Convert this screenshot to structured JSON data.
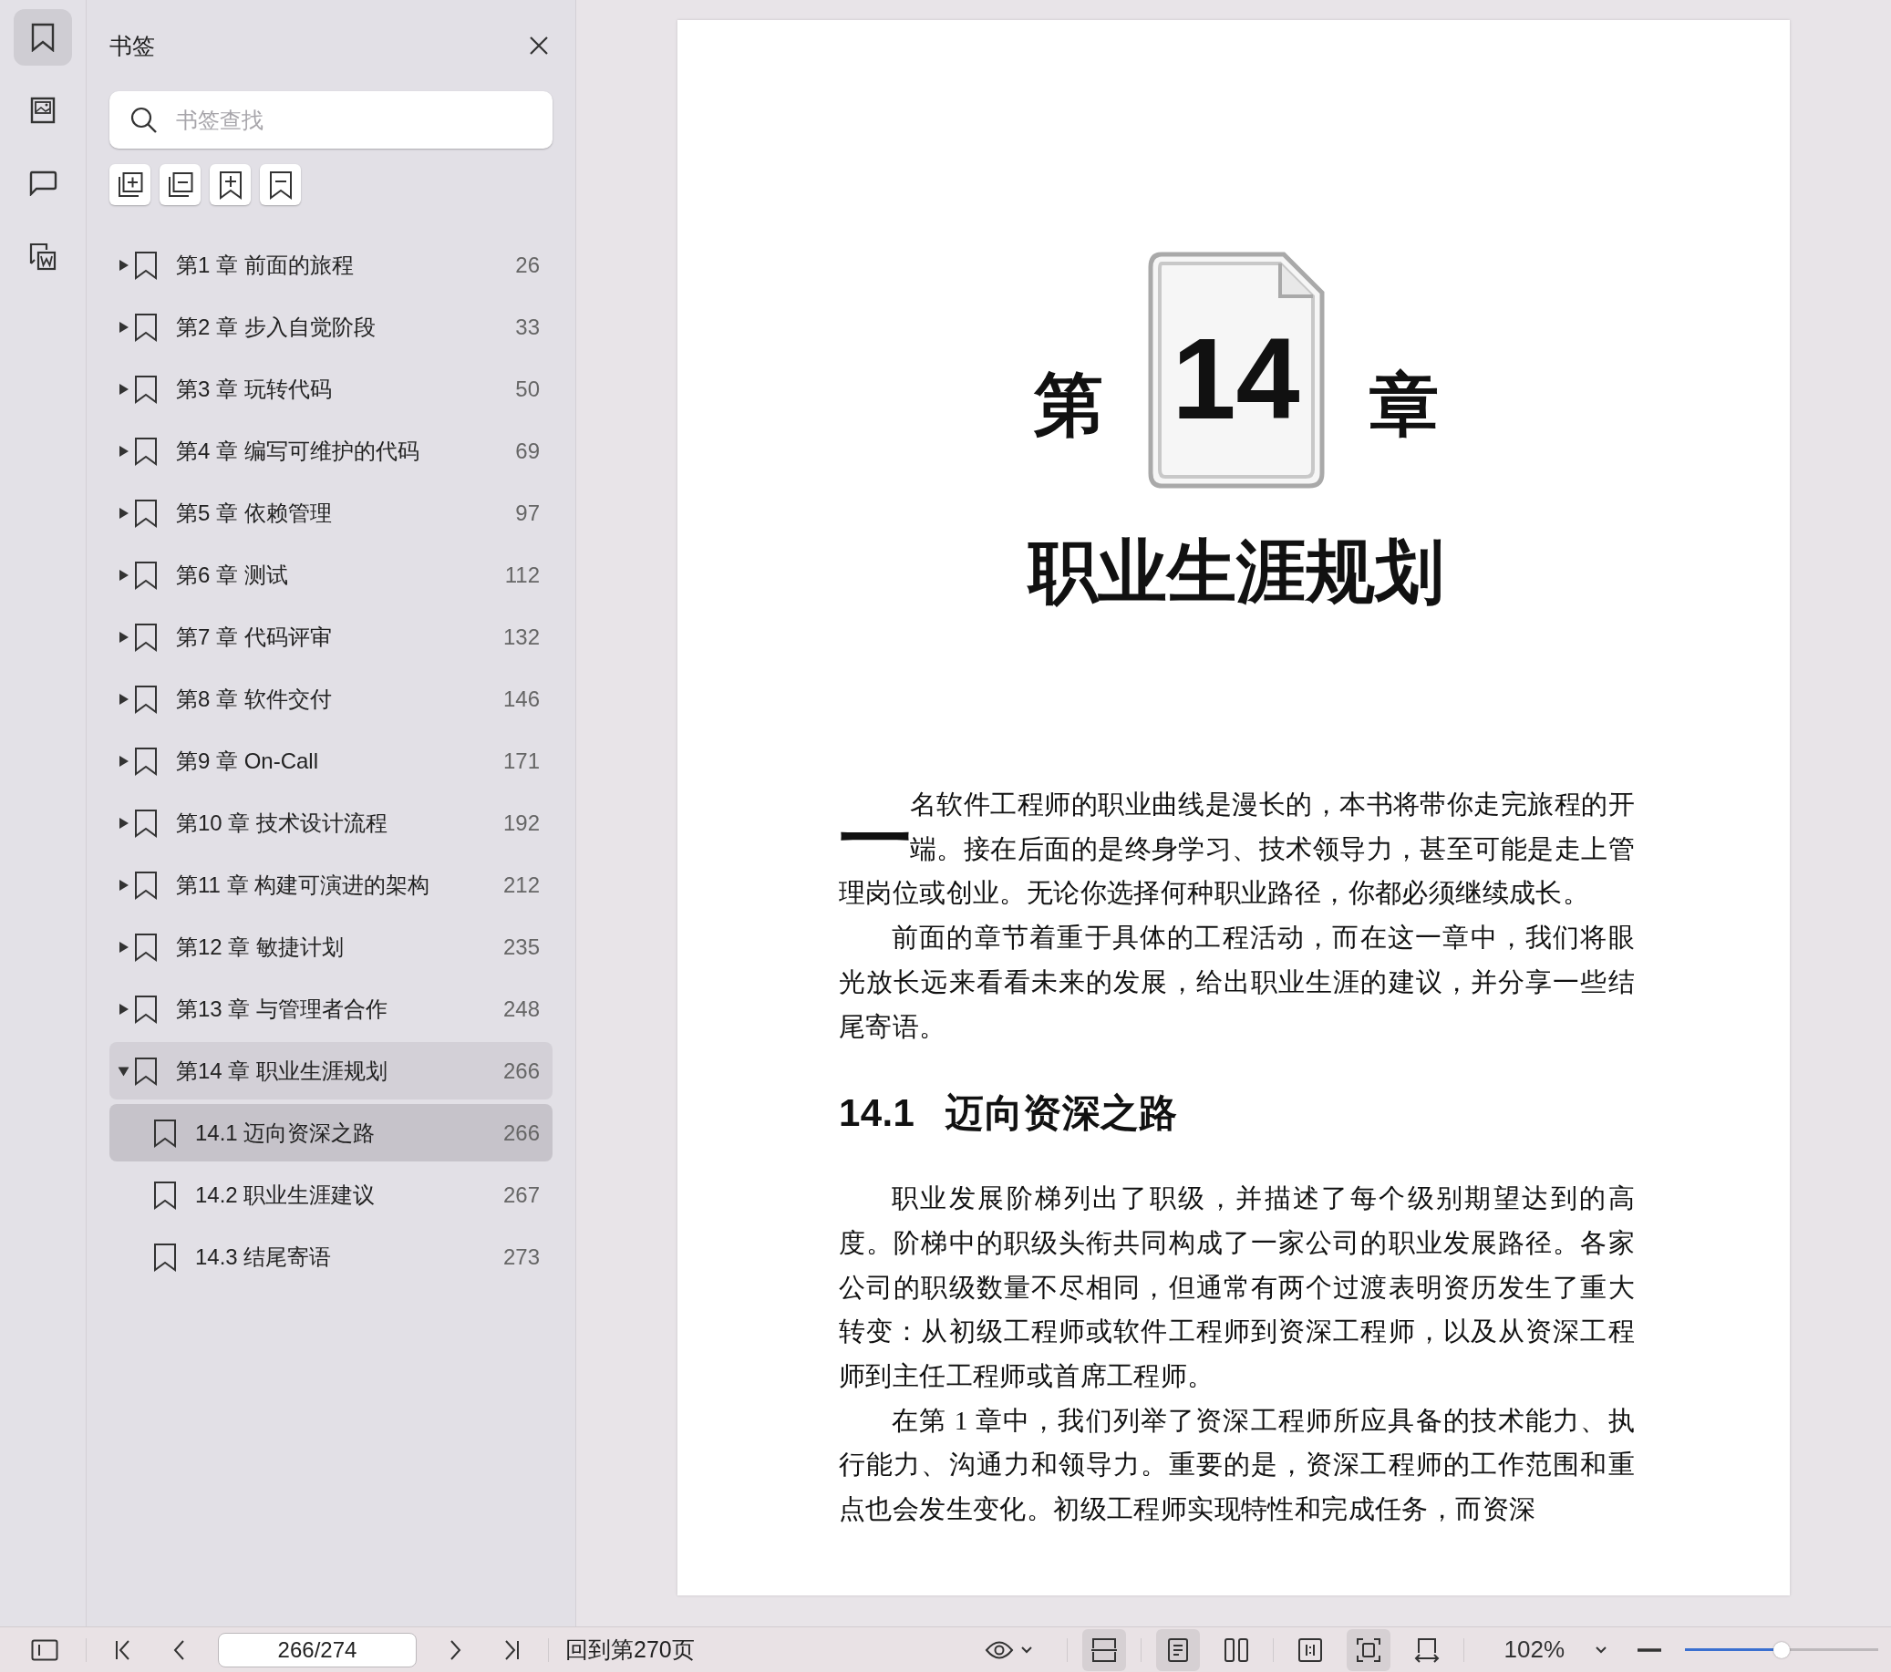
{
  "rail": [
    {
      "kind": "bookmark",
      "selected": true
    },
    {
      "kind": "image",
      "selected": false
    },
    {
      "kind": "comment",
      "selected": false
    },
    {
      "kind": "convert",
      "selected": false
    }
  ],
  "sidebar": {
    "title": "书签",
    "search": {
      "placeholder": "书签查找"
    },
    "tools": [
      {
        "kind": "expand"
      },
      {
        "kind": "collapse"
      },
      {
        "kind": "add"
      },
      {
        "kind": "remove"
      }
    ],
    "bookmarks": [
      {
        "label": "第1 章 前面的旅程",
        "page": "26",
        "expanded": false,
        "selected": false,
        "highlighted": false
      },
      {
        "label": "第2 章 步入自觉阶段",
        "page": "33",
        "expanded": false,
        "selected": false,
        "highlighted": false
      },
      {
        "label": "第3 章 玩转代码",
        "page": "50",
        "expanded": false,
        "selected": false,
        "highlighted": false
      },
      {
        "label": "第4 章 编写可维护的代码",
        "page": "69",
        "expanded": false,
        "selected": false,
        "highlighted": false
      },
      {
        "label": "第5 章 依赖管理",
        "page": "97",
        "expanded": false,
        "selected": false,
        "highlighted": false
      },
      {
        "label": "第6 章 测试",
        "page": "112",
        "expanded": false,
        "selected": false,
        "highlighted": false
      },
      {
        "label": "第7 章 代码评审",
        "page": "132",
        "expanded": false,
        "selected": false,
        "highlighted": false
      },
      {
        "label": "第8 章 软件交付",
        "page": "146",
        "expanded": false,
        "selected": false,
        "highlighted": false
      },
      {
        "label": "第9 章 On-Call",
        "page": "171",
        "expanded": false,
        "selected": false,
        "highlighted": false
      },
      {
        "label": "第10 章 技术设计流程",
        "page": "192",
        "expanded": false,
        "selected": false,
        "highlighted": false
      },
      {
        "label": "第11 章 构建可演进的架构",
        "page": "212",
        "expanded": false,
        "selected": false,
        "highlighted": false
      },
      {
        "label": "第12 章 敏捷计划",
        "page": "235",
        "expanded": false,
        "selected": false,
        "highlighted": false
      },
      {
        "label": "第13 章 与管理者合作",
        "page": "248",
        "expanded": false,
        "selected": false,
        "highlighted": false
      },
      {
        "label": "第14 章 职业生涯规划",
        "page": "266",
        "expanded": true,
        "selected": false,
        "highlighted": true,
        "children": [
          {
            "label": "14.1 迈向资深之路",
            "page": "266",
            "selected": true
          },
          {
            "label": "14.2 职业生涯建议",
            "page": "267",
            "selected": false
          },
          {
            "label": "14.3 结尾寄语",
            "page": "273",
            "selected": false
          }
        ]
      }
    ]
  },
  "document": {
    "chapter_prefix": "第",
    "chapter_number": "14",
    "chapter_suffix": "章",
    "chapter_title": "职业生涯规划",
    "blocks": [
      {
        "kind": "dropcap",
        "initial": "一",
        "text": "名软件工程师的职业曲线是漫长的，本书将带你走完旅程的开端。接在后面的是终身学习、技术领导力，甚至可能是走上管理岗位或创业。无论你选择何种职业路径，你都必须继续成长。"
      },
      {
        "kind": "paragraph",
        "text": "前面的章节着重于具体的工程活动，而在这一章中，我们将眼光放长远来看看未来的发展，给出职业生涯的建议，并分享一些结尾寄语。"
      },
      {
        "kind": "heading",
        "number": "14.1",
        "text": "迈向资深之路"
      },
      {
        "kind": "paragraph",
        "text": "职业发展阶梯列出了职级，并描述了每个级别期望达到的高度。阶梯中的职级头衔共同构成了一家公司的职业发展路径。各家公司的职级数量不尽相同，但通常有两个过渡表明资历发生了重大转变：从初级工程师或软件工程师到资深工程师，以及从资深工程师到主任工程师或首席工程师。"
      },
      {
        "kind": "paragraph",
        "text": "在第 1 章中，我们列举了资深工程师所应具备的技术能力、执行能力、沟通力和领导力。重要的是，资深工程师的工作范围和重点也会发生变化。初级工程师实现特性和完成任务，而资深"
      }
    ]
  },
  "toolbar": {
    "page_field": "266/274",
    "goto": "回到第270页",
    "view_buttons": [
      {
        "kind": "fit-width",
        "selected": true
      },
      {
        "kind": "single-page",
        "selected": true
      },
      {
        "kind": "two-page",
        "selected": false
      },
      {
        "kind": "split",
        "selected": false
      },
      {
        "kind": "fit-page",
        "selected": true
      },
      {
        "kind": "rotate",
        "selected": false
      }
    ],
    "zoom": "102%",
    "zoom_slider": {
      "level": 0.5
    }
  }
}
